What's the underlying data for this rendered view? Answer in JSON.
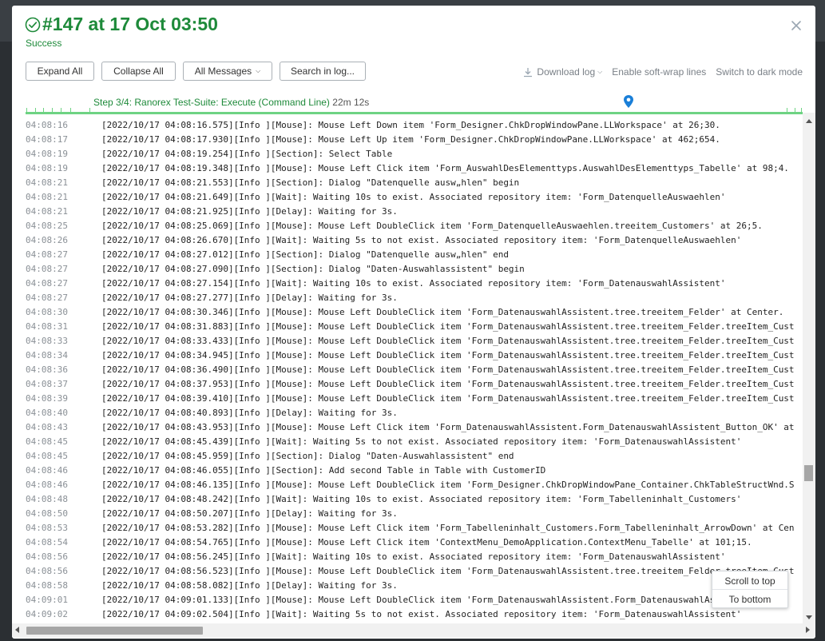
{
  "header": {
    "title": "#147 at 17 Oct 03:50",
    "status": "Success",
    "success_color": "#1e8a3a"
  },
  "toolbar": {
    "expand_all": "Expand All",
    "collapse_all": "Collapse All",
    "all_messages": "All Messages",
    "search_log": "Search in log...",
    "download_log": "Download log",
    "soft_wrap": "Enable soft-wrap lines",
    "dark_mode": "Switch to dark mode"
  },
  "timeline": {
    "step_label": "Step 3/4: Ranorex Test-Suite: Execute (Command Line)",
    "step_duration": "22m 12s"
  },
  "log": [
    {
      "time": "04:08:16",
      "text": "[2022/10/17 04:08:16.575][Info    ][Mouse]: Mouse Left Down item 'Form_Designer.ChkDropWindowPane.LLWorkspace' at 26;30."
    },
    {
      "time": "04:08:17",
      "text": "[2022/10/17 04:08:17.930][Info    ][Mouse]: Mouse Left Up item 'Form_Designer.ChkDropWindowPane.LLWorkspace' at 462;654."
    },
    {
      "time": "04:08:19",
      "text": "[2022/10/17 04:08:19.254][Info    ][Section]: Select Table"
    },
    {
      "time": "04:08:19",
      "text": "[2022/10/17 04:08:19.348][Info    ][Mouse]: Mouse Left Click item 'Form_AuswahlDesElementtyps.AuswahlDesElementtyps_Tabelle' at 98;4."
    },
    {
      "time": "04:08:21",
      "text": "[2022/10/17 04:08:21.553][Info    ][Section]: Dialog \"Datenquelle ausw„hlen\" begin"
    },
    {
      "time": "04:08:21",
      "text": "[2022/10/17 04:08:21.649][Info    ][Wait]: Waiting 10s to exist. Associated repository item: 'Form_DatenquelleAuswaehlen'"
    },
    {
      "time": "04:08:21",
      "text": "[2022/10/17 04:08:21.925][Info    ][Delay]: Waiting for 3s."
    },
    {
      "time": "04:08:25",
      "text": "[2022/10/17 04:08:25.069][Info    ][Mouse]: Mouse Left DoubleClick item 'Form_DatenquelleAuswaehlen.treeitem_Customers' at 26;5."
    },
    {
      "time": "04:08:26",
      "text": "[2022/10/17 04:08:26.670][Info    ][Wait]: Waiting 5s to not exist. Associated repository item: 'Form_DatenquelleAuswaehlen'"
    },
    {
      "time": "04:08:27",
      "text": "[2022/10/17 04:08:27.012][Info    ][Section]: Dialog \"Datenquelle ausw„hlen\" end"
    },
    {
      "time": "04:08:27",
      "text": "[2022/10/17 04:08:27.090][Info    ][Section]: Dialog \"Daten-Auswahlassistent\" begin"
    },
    {
      "time": "04:08:27",
      "text": "[2022/10/17 04:08:27.154][Info    ][Wait]: Waiting 10s to exist. Associated repository item: 'Form_DatenauswahlAssistent'"
    },
    {
      "time": "04:08:27",
      "text": "[2022/10/17 04:08:27.277][Info    ][Delay]: Waiting for 3s."
    },
    {
      "time": "04:08:30",
      "text": "[2022/10/17 04:08:30.346][Info    ][Mouse]: Mouse Left DoubleClick item 'Form_DatenauswahlAssistent.tree.treeitem_Felder' at Center."
    },
    {
      "time": "04:08:31",
      "text": "[2022/10/17 04:08:31.883][Info    ][Mouse]: Mouse Left DoubleClick item 'Form_DatenauswahlAssistent.tree.treeitem_Felder.treeItem_Cust"
    },
    {
      "time": "04:08:33",
      "text": "[2022/10/17 04:08:33.433][Info    ][Mouse]: Mouse Left DoubleClick item 'Form_DatenauswahlAssistent.tree.treeitem_Felder.treeItem_Cust"
    },
    {
      "time": "04:08:34",
      "text": "[2022/10/17 04:08:34.945][Info    ][Mouse]: Mouse Left DoubleClick item 'Form_DatenauswahlAssistent.tree.treeitem_Felder.treeItem_Cust"
    },
    {
      "time": "04:08:36",
      "text": "[2022/10/17 04:08:36.490][Info    ][Mouse]: Mouse Left DoubleClick item 'Form_DatenauswahlAssistent.tree.treeitem_Felder.treeItem_Cust"
    },
    {
      "time": "04:08:37",
      "text": "[2022/10/17 04:08:37.953][Info    ][Mouse]: Mouse Left DoubleClick item 'Form_DatenauswahlAssistent.tree.treeitem_Felder.treeItem_Cust"
    },
    {
      "time": "04:08:39",
      "text": "[2022/10/17 04:08:39.410][Info    ][Mouse]: Mouse Left DoubleClick item 'Form_DatenauswahlAssistent.tree.treeitem_Felder.treeItem_Cust"
    },
    {
      "time": "04:08:40",
      "text": "[2022/10/17 04:08:40.893][Info    ][Delay]: Waiting for 3s."
    },
    {
      "time": "04:08:43",
      "text": "[2022/10/17 04:08:43.953][Info    ][Mouse]: Mouse Left Click item 'Form_DatenauswahlAssistent.Form_DatenauswahlAssistent_Button_OK' at"
    },
    {
      "time": "04:08:45",
      "text": "[2022/10/17 04:08:45.439][Info    ][Wait]: Waiting 5s to not exist. Associated repository item: 'Form_DatenauswahlAssistent'"
    },
    {
      "time": "04:08:45",
      "text": "[2022/10/17 04:08:45.959][Info    ][Section]: Dialog \"Daten-Auswahlassistent\" end"
    },
    {
      "time": "04:08:46",
      "text": "[2022/10/17 04:08:46.055][Info    ][Section]: Add second Table in Table with CustomerID"
    },
    {
      "time": "04:08:46",
      "text": "[2022/10/17 04:08:46.135][Info    ][Mouse]: Mouse Left DoubleClick item 'Form_Designer.ChkDropWindowPane_Container.ChkTableStructWnd.S"
    },
    {
      "time": "04:08:48",
      "text": "[2022/10/17 04:08:48.242][Info    ][Wait]: Waiting 10s to exist. Associated repository item: 'Form_Tabelleninhalt_Customers'"
    },
    {
      "time": "04:08:50",
      "text": "[2022/10/17 04:08:50.207][Info    ][Delay]: Waiting for 3s."
    },
    {
      "time": "04:08:53",
      "text": "[2022/10/17 04:08:53.282][Info    ][Mouse]: Mouse Left Click item 'Form_Tabelleninhalt_Customers.Form_Tabelleninhalt_ArrowDown' at Cen"
    },
    {
      "time": "04:08:54",
      "text": "[2022/10/17 04:08:54.765][Info    ][Mouse]: Mouse Left Click item 'ContextMenu_DemoApplication.ContextMenu_Tabelle' at 101;15."
    },
    {
      "time": "04:08:56",
      "text": "[2022/10/17 04:08:56.245][Info    ][Wait]: Waiting 10s to exist. Associated repository item: 'Form_DatenauswahlAssistent'"
    },
    {
      "time": "04:08:56",
      "text": "[2022/10/17 04:08:56.523][Info    ][Mouse]: Mouse Left DoubleClick item 'Form_DatenauswahlAssistent.tree.treeitem_Felder.treeItem_Cust"
    },
    {
      "time": "04:08:58",
      "text": "[2022/10/17 04:08:58.082][Info    ][Delay]: Waiting for 3s."
    },
    {
      "time": "04:09:01",
      "text": "[2022/10/17 04:09:01.133][Info    ][Mouse]: Mouse Left DoubleClick item 'Form_DatenauswahlAssistent.Form_DatenauswahlAssist"
    },
    {
      "time": "04:09:02",
      "text": "[2022/10/17 04:09:02.504][Info    ][Wait]: Waiting 5s to not exist. Associated repository item: 'Form_DatenauswahlAssistent'"
    }
  ],
  "scroll_menu": {
    "to_top": "Scroll to top",
    "to_bottom": "To bottom"
  }
}
